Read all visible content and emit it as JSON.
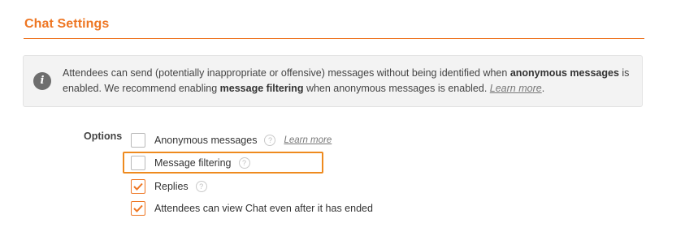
{
  "section": {
    "title": "Chat Settings"
  },
  "info": {
    "icon": "info-icon",
    "text_part1": "Attendees can send (potentially inappropriate or offensive) messages without being identified when ",
    "bold1": "anonymous messages",
    "text_part2": " is enabled. We recommend enabling ",
    "bold2": "message filtering",
    "text_part3": " when anonymous messages is enabled. ",
    "link": "Learn more",
    "text_part4": "."
  },
  "options": {
    "label": "Options",
    "items": [
      {
        "label": "Anonymous messages",
        "checked": false,
        "help_icon": true,
        "link": "Learn more"
      },
      {
        "label": "Message filtering",
        "checked": false,
        "help_icon": true,
        "highlighted": true
      },
      {
        "label": "Replies",
        "checked": true,
        "help_icon": true
      },
      {
        "label": "Attendees can view Chat even after it has ended",
        "checked": true,
        "help_icon": false
      }
    ]
  },
  "colors": {
    "accent": "#ee7623",
    "highlight": "#ee8a1e",
    "info_bg": "#f3f3f3"
  }
}
